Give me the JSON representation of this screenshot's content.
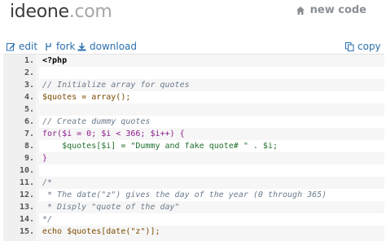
{
  "header": {
    "logo_name": "ideone",
    "logo_tld": ".com",
    "new_code_label": "new code"
  },
  "toolbar": {
    "edit_label": "edit",
    "fork_label": "fork",
    "download_label": "download",
    "copy_label": "copy"
  },
  "code": {
    "line_numbers": [
      "1.",
      "2.",
      "3.",
      "4.",
      "5.",
      "6.",
      "7.",
      "8.",
      "9.",
      "10.",
      "11.",
      "12.",
      "13.",
      "14.",
      "15."
    ],
    "lines": [
      "<?php",
      "",
      "// Initialize array for quotes",
      "$quotes = array();",
      "",
      "// Create dummy quotes",
      "for($i = 0; $i < 366; $i++) {",
      "    $quotes[$i] = \"Dummy and fake quote# \" . $i;",
      "}",
      "",
      "/*",
      " * The date(\"z\") gives the day of the year (0 through 365)",
      " * Disply \"quote of the day\"",
      "*/",
      "echo $quotes[date(\"z\")];"
    ]
  },
  "colors": {
    "link": "#2a6fad",
    "header_gray": "#8a8f94"
  },
  "icons": {
    "new_code": "home-icon",
    "edit": "pencil-icon",
    "fork": "fork-icon",
    "download": "download-icon",
    "copy": "copy-icon"
  }
}
